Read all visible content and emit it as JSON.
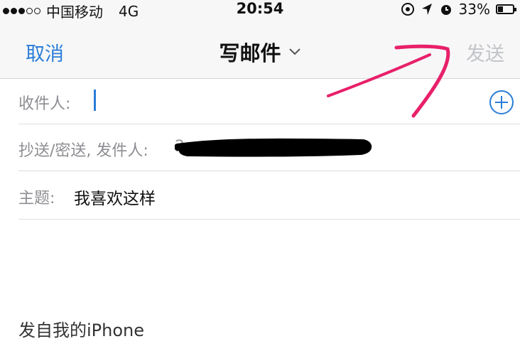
{
  "status_bar": {
    "carrier": "中国移动",
    "network": "4G",
    "time": "20:54",
    "battery_percent": "33%",
    "battery_level": 0.33,
    "signal_bars_filled": 3,
    "signal_bars_total": 5
  },
  "nav": {
    "cancel_label": "取消",
    "title": "写邮件",
    "send_label": "发送"
  },
  "compose": {
    "to_label": "收件人:",
    "to_value": "",
    "cc_label": "抄送/密送, 发件人:",
    "cc_value_visible": "2",
    "subject_label": "主题:",
    "subject_value": "我喜欢这样",
    "signature": "发自我的iPhone"
  },
  "colors": {
    "accent": "#2a7dd8",
    "send_disabled": "#c2c4c8",
    "annotation": "#e8206a",
    "label_gray": "#8e8e93"
  },
  "icons": [
    "location-icon",
    "arrow-icon",
    "alarm-icon",
    "battery-icon",
    "chevron-down-icon",
    "add-contact-icon"
  ]
}
